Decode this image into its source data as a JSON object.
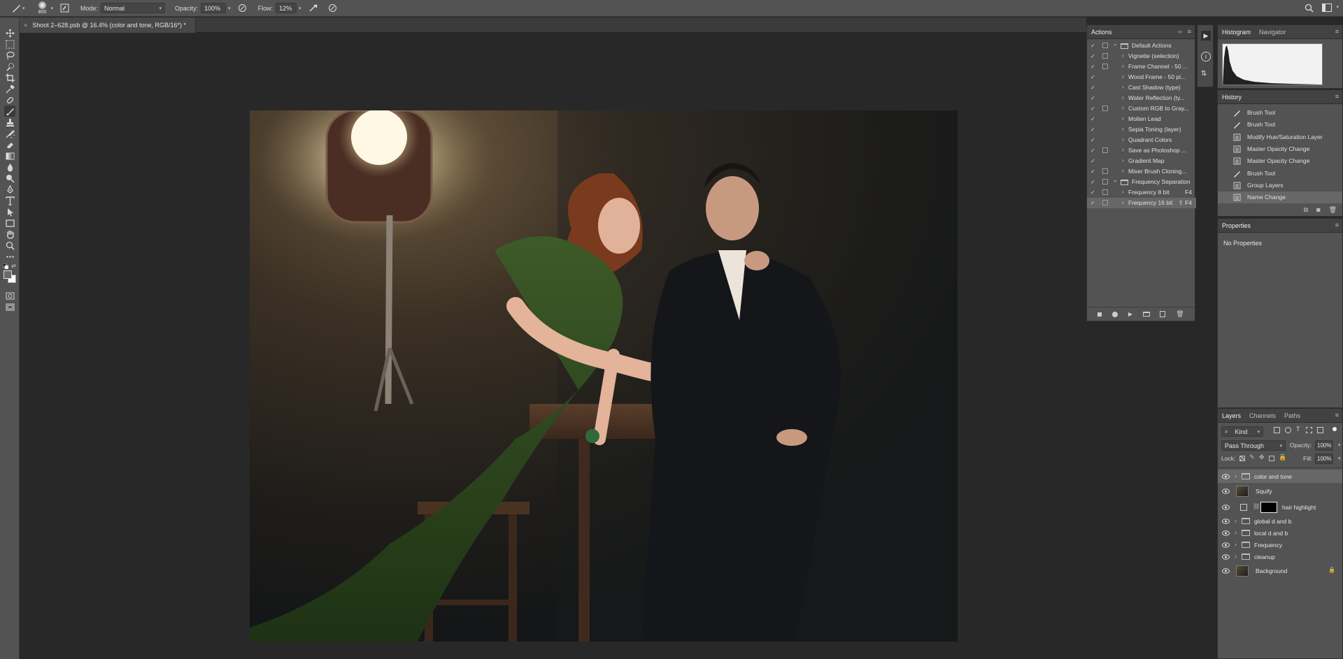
{
  "options_bar": {
    "brush_size": "800",
    "mode_label": "Mode:",
    "mode_value": "Normal",
    "opacity_label": "Opacity:",
    "opacity_value": "100%",
    "flow_label": "Flow:",
    "flow_value": "12%"
  },
  "document": {
    "tab_title": "Shoot 2–628.psb @ 16.4% (color and tone, RGB/16*) *"
  },
  "actions": {
    "title": "Actions",
    "items": [
      {
        "label": "Default Actions",
        "type": "set",
        "expanded": true,
        "dialog": true
      },
      {
        "label": "Vignette (selection)",
        "type": "action",
        "dialog": true
      },
      {
        "label": "Frame Channel - 50 ...",
        "type": "action",
        "dialog": true
      },
      {
        "label": "Wood Frame - 50 pi...",
        "type": "action",
        "dialog": false
      },
      {
        "label": "Cast Shadow (type)",
        "type": "action",
        "dialog": false
      },
      {
        "label": "Water Reflection (ty...",
        "type": "action",
        "dialog": false
      },
      {
        "label": "Custom RGB to Gray...",
        "type": "action",
        "dialog": true
      },
      {
        "label": "Molten Lead",
        "type": "action",
        "dialog": false
      },
      {
        "label": "Sepia Toning (layer)",
        "type": "action",
        "dialog": false
      },
      {
        "label": "Quadrant Colors",
        "type": "action",
        "dialog": false
      },
      {
        "label": "Save as Photoshop ...",
        "type": "action",
        "dialog": true
      },
      {
        "label": "Gradient Map",
        "type": "action",
        "dialog": false
      },
      {
        "label": "Mixer Brush Cloning...",
        "type": "action",
        "dialog": true
      },
      {
        "label": "Frequency Separation",
        "type": "set",
        "expanded": true,
        "dialog": true
      },
      {
        "label": "Frequency 8 bit",
        "shortcut": "F4",
        "type": "action",
        "dialog": true
      },
      {
        "label": "Frequency 16 bit",
        "shortcut": "⇧ F4",
        "type": "action",
        "dialog": true,
        "selected": true
      }
    ]
  },
  "histogram": {
    "tabs": [
      "Histogram",
      "Navigator"
    ]
  },
  "history": {
    "title": "History",
    "items": [
      {
        "label": "Brush Tool",
        "icon": "brush"
      },
      {
        "label": "Brush Tool",
        "icon": "brush"
      },
      {
        "label": "Modify Hue/Saturation Layer",
        "icon": "doc"
      },
      {
        "label": "Master Opacity Change",
        "icon": "doc"
      },
      {
        "label": "Master Opacity Change",
        "icon": "doc"
      },
      {
        "label": "Brush Tool",
        "icon": "brush"
      },
      {
        "label": "Group Layers",
        "icon": "doc"
      },
      {
        "label": "Name Change",
        "icon": "doc",
        "selected": true
      }
    ]
  },
  "properties": {
    "title": "Properties",
    "empty_text": "No Properties"
  },
  "layers": {
    "tabs": [
      "Layers",
      "Channels",
      "Paths"
    ],
    "filter_label": "Kind",
    "blend_mode": "Pass Through",
    "opacity_label": "Opacity:",
    "opacity_value": "100%",
    "lock_label": "Lock:",
    "fill_label": "Fill:",
    "fill_value": "100%",
    "items": [
      {
        "name": "color and tone",
        "kind": "group",
        "selected": true
      },
      {
        "name": "Squify",
        "kind": "pixel"
      },
      {
        "name": "hair highlight",
        "kind": "adjustment"
      },
      {
        "name": "global d and b",
        "kind": "group"
      },
      {
        "name": "local d and b",
        "kind": "group"
      },
      {
        "name": "Frequency",
        "kind": "group"
      },
      {
        "name": "cleanup",
        "kind": "group"
      },
      {
        "name": "Background",
        "kind": "pixel",
        "locked": true
      }
    ]
  },
  "colors": {
    "panel": "#535353",
    "panel_header": "#424242",
    "canvas": "#282828",
    "selected_row": "#676767"
  }
}
